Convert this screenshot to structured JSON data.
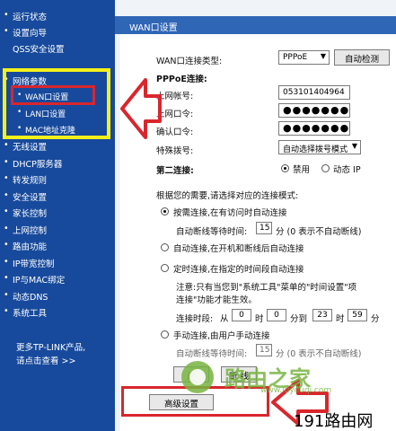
{
  "sidebar": {
    "items": [
      {
        "label": "运行状态"
      },
      {
        "label": "设置向导"
      },
      {
        "label": "QSS安全设置"
      },
      {
        "label": "网络参数"
      },
      {
        "label": "WAN口设置"
      },
      {
        "label": "LAN口设置"
      },
      {
        "label": "MAC地址克隆"
      },
      {
        "label": "无线设置"
      },
      {
        "label": "DHCP服务器"
      },
      {
        "label": "转发规则"
      },
      {
        "label": "安全设置"
      },
      {
        "label": "家长控制"
      },
      {
        "label": "上网控制"
      },
      {
        "label": "路由功能"
      },
      {
        "label": "IP带宽控制"
      },
      {
        "label": "IP与MAC绑定"
      },
      {
        "label": "动态DNS"
      },
      {
        "label": "系统工具"
      }
    ],
    "more_line1": "更多TP-LINK产品,",
    "more_line2": "请点击查看 >>"
  },
  "main": {
    "header": "WAN口设置",
    "wan_type_label": "WAN口连接类型:",
    "wan_type_value": "PPPoE",
    "auto_detect": "自动检测",
    "pppoe_label": "PPPoE连接:",
    "account_label": "上网帐号:",
    "account_value": "053101404964",
    "password_label": "上网口令:",
    "password_value": "●●●●●●●●●●●●●",
    "confirm_label": "确认口令:",
    "confirm_value": "●●●●●●●●●●●●●",
    "dial_label": "特殊拨号:",
    "dial_value": "自动选择拨号模式",
    "second_label": "第二连接:",
    "second_disable": "禁用",
    "second_dynamic": "动态 IP",
    "mode_intro": "根据您的需要,请选择对应的连接模式:",
    "opt1": "按需连接,在有访问时自动连接",
    "opt1_idle": "自动断线等待时间:",
    "opt1_idle_value": "15",
    "opt1_idle_unit": "分  (0 表示不自动断线)",
    "opt2": "自动连接,在开机和断线后自动连接",
    "opt3": "定时连接,在指定的时间段自动连接",
    "opt3_note1": "注意:只有当您到\"系统工具\"菜单的\"时间设置\"项",
    "opt3_note2": "连接\"功能才能生效。",
    "time_label": "连接时段:",
    "time_from": "从",
    "t1": "0",
    "t_hour1": "时",
    "t2": "0",
    "t_min1": "分到",
    "t3": "23",
    "t_hour2": "时",
    "t4": "59",
    "t_min2": "分",
    "opt4": "手动连接,由用户手动连接",
    "opt4_idle": "自动断线等待时间:",
    "opt4_idle_value": "15",
    "opt4_idle_unit": "分  (0 表示不自动断线)",
    "btn_connect": "连",
    "btn_disconnect": "断  线",
    "advanced": "高级设置"
  },
  "watermark": {
    "text": "路由之家",
    "url": "www.luyouqi.com"
  },
  "brand": "191路由网"
}
